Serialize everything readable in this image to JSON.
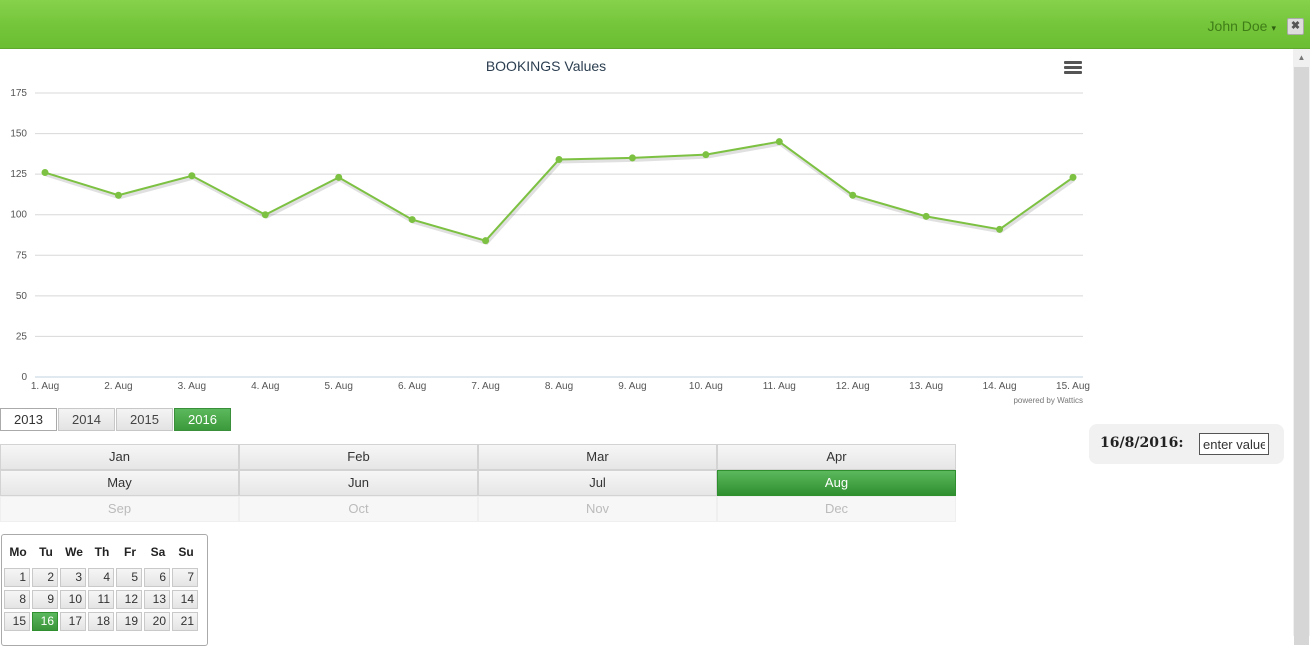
{
  "header": {
    "user_name": "John Doe",
    "caret": "▾",
    "close": "✖"
  },
  "chart_data": {
    "type": "line",
    "title": "BOOKINGS Values",
    "categories": [
      "1. Aug",
      "2. Aug",
      "3. Aug",
      "4. Aug",
      "5. Aug",
      "6. Aug",
      "7. Aug",
      "8. Aug",
      "9. Aug",
      "10. Aug",
      "11. Aug",
      "12. Aug",
      "13. Aug",
      "14. Aug",
      "15. Aug"
    ],
    "values": [
      126,
      112,
      124,
      100,
      123,
      97,
      84,
      134,
      135,
      137,
      145,
      112,
      99,
      91,
      123
    ],
    "ylim": [
      0,
      175
    ],
    "yticks": [
      0,
      25,
      50,
      75,
      100,
      125,
      150,
      175
    ],
    "grid": true,
    "credit": "powered by Wattics",
    "line_color": "#7dc142"
  },
  "years": [
    "2013",
    "2014",
    "2015",
    "2016"
  ],
  "months": [
    [
      "Jan",
      "Feb",
      "Mar",
      "Apr"
    ],
    [
      "May",
      "Jun",
      "Jul",
      "Aug"
    ],
    [
      "Sep",
      "Oct",
      "Nov",
      "Dec"
    ]
  ],
  "calendar": {
    "weekdays": [
      "Mo",
      "Tu",
      "We",
      "Th",
      "Fr",
      "Sa",
      "Su"
    ],
    "weeks": [
      [
        "1",
        "2",
        "3",
        "4",
        "5",
        "6",
        "7"
      ],
      [
        "8",
        "9",
        "10",
        "11",
        "12",
        "13",
        "14"
      ],
      [
        "15",
        "16",
        "17",
        "18",
        "19",
        "20",
        "21"
      ]
    ],
    "selected": "16"
  },
  "date_entry": {
    "label": "16/8/2016:",
    "placeholder": "enter value"
  },
  "colors": {
    "accent": "#4cae4c",
    "topbar": "#7cc943"
  }
}
